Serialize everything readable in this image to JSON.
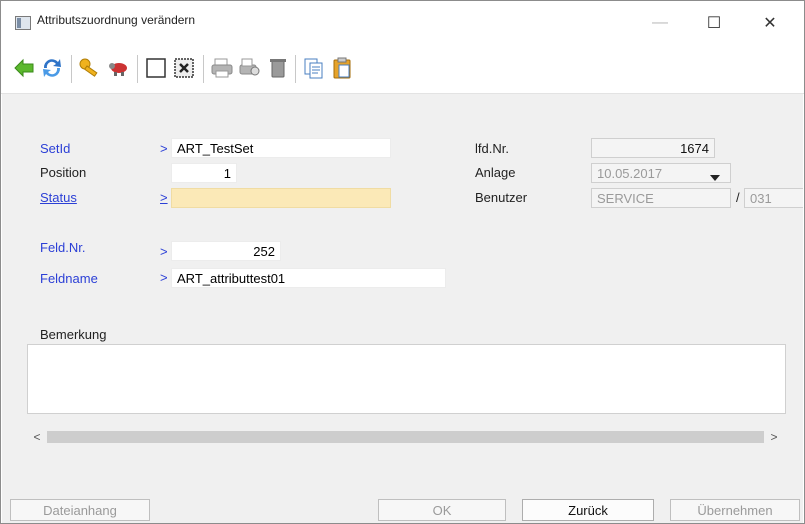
{
  "window": {
    "title": "Attributszuordnung verändern",
    "minimize": "—",
    "maximize": "☐",
    "close": "✕"
  },
  "toolbar": {
    "icons": [
      "back-icon",
      "refresh-icon",
      "key-icon",
      "animal-icon",
      "select-all-icon",
      "deselect-icon",
      "print-icon",
      "print-preview-icon",
      "delete-icon",
      "copy-icon",
      "paste-icon"
    ]
  },
  "form": {
    "setid": {
      "label": "SetId",
      "arrow": ">",
      "value": "ART_TestSet"
    },
    "position": {
      "label": "Position",
      "value": "1"
    },
    "status": {
      "label": "Status",
      "arrow": ">",
      "value": ""
    },
    "feldnr": {
      "label": "Feld.Nr.",
      "arrow": ">",
      "value": "252"
    },
    "feldname": {
      "label": "Feldname",
      "arrow": ">",
      "value": "ART_attributtest01"
    },
    "lfdnr": {
      "label": "lfd.Nr.",
      "value": "1674"
    },
    "anlage": {
      "label": "Anlage",
      "value": "10.05.2017"
    },
    "benutzer": {
      "label": "Benutzer",
      "value": "SERVICE",
      "sep": "/",
      "extra": "031"
    },
    "bemerkung": {
      "label": "Bemerkung",
      "value": ""
    }
  },
  "scrollbar": {
    "left": "<",
    "right": ">"
  },
  "buttons": {
    "dateianhang": "Dateianhang",
    "ok": "OK",
    "zurueck": "Zurück",
    "uebernehmen": "Übernehmen"
  }
}
